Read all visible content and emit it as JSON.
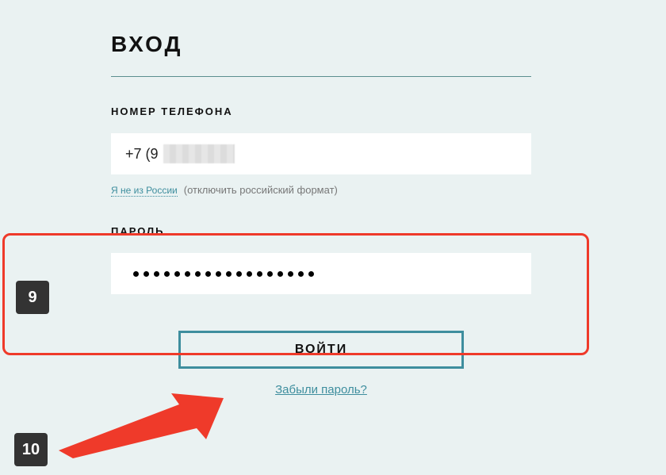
{
  "title": "ВХОД",
  "phone": {
    "label": "НОМЕР ТЕЛЕФОНА",
    "value_prefix": "+7 (9",
    "toggle_link": "Я не из России",
    "toggle_hint": "(отключить российский формат)"
  },
  "password": {
    "label": "ПАРОЛЬ",
    "mask_length": 18
  },
  "submit_label": "ВОЙТИ",
  "forgot_label": "Забыли пароль?",
  "annotations": {
    "badge9": "9",
    "badge10": "10"
  }
}
